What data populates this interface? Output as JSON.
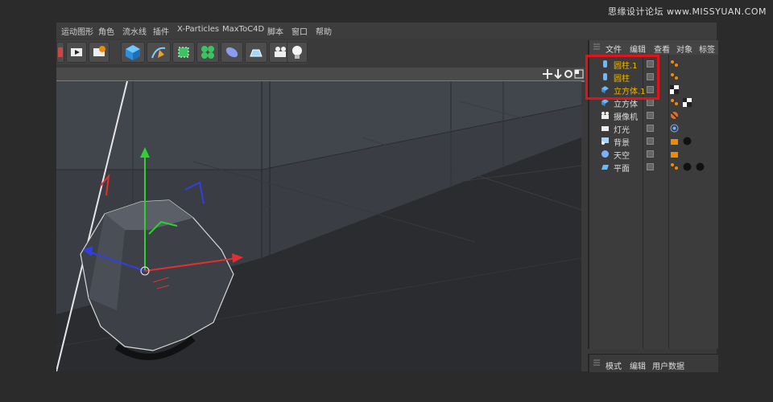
{
  "watermark": "思缘设计论坛 www.MISSYUAN.COM",
  "menu": [
    "运动图形",
    "角色",
    "流水线",
    "插件",
    "X-Particles",
    "MaxToC4D",
    "脚本",
    "窗口",
    "帮助"
  ],
  "toolbar_icons": [
    "render-view-icon",
    "render-settings-icon",
    "cube-icon",
    "pen-icon",
    "subdivision-icon",
    "array-icon",
    "deformer-icon",
    "floor-icon",
    "camera-icon",
    "light-icon"
  ],
  "object_manager": {
    "tabs": [
      "文件",
      "编辑",
      "查看",
      "对象",
      "标签"
    ],
    "objects": [
      {
        "name": "圆柱.1",
        "icon": "cylinder-icon",
        "selected": true
      },
      {
        "name": "圆柱",
        "icon": "cylinder-icon",
        "selected": true
      },
      {
        "name": "立方体.1",
        "icon": "cube-icon",
        "selected": true
      },
      {
        "name": "立方体",
        "icon": "cube-icon",
        "selected": false
      },
      {
        "name": "摄像机",
        "icon": "camera-icon",
        "selected": false
      },
      {
        "name": "灯光",
        "icon": "light-icon",
        "selected": false
      },
      {
        "name": "背景",
        "icon": "background-icon",
        "selected": false
      },
      {
        "name": "天空",
        "icon": "sky-icon",
        "selected": false
      },
      {
        "name": "平面",
        "icon": "plane-icon",
        "selected": false
      }
    ]
  },
  "attribute_manager": {
    "tabs": [
      "模式",
      "编辑",
      "用户数据"
    ]
  },
  "colors": {
    "accent_selected": "#f0b400",
    "highlight_box": "#e0141a",
    "axis_x": "#e03030",
    "axis_y": "#30d030",
    "axis_z": "#3040e0"
  }
}
